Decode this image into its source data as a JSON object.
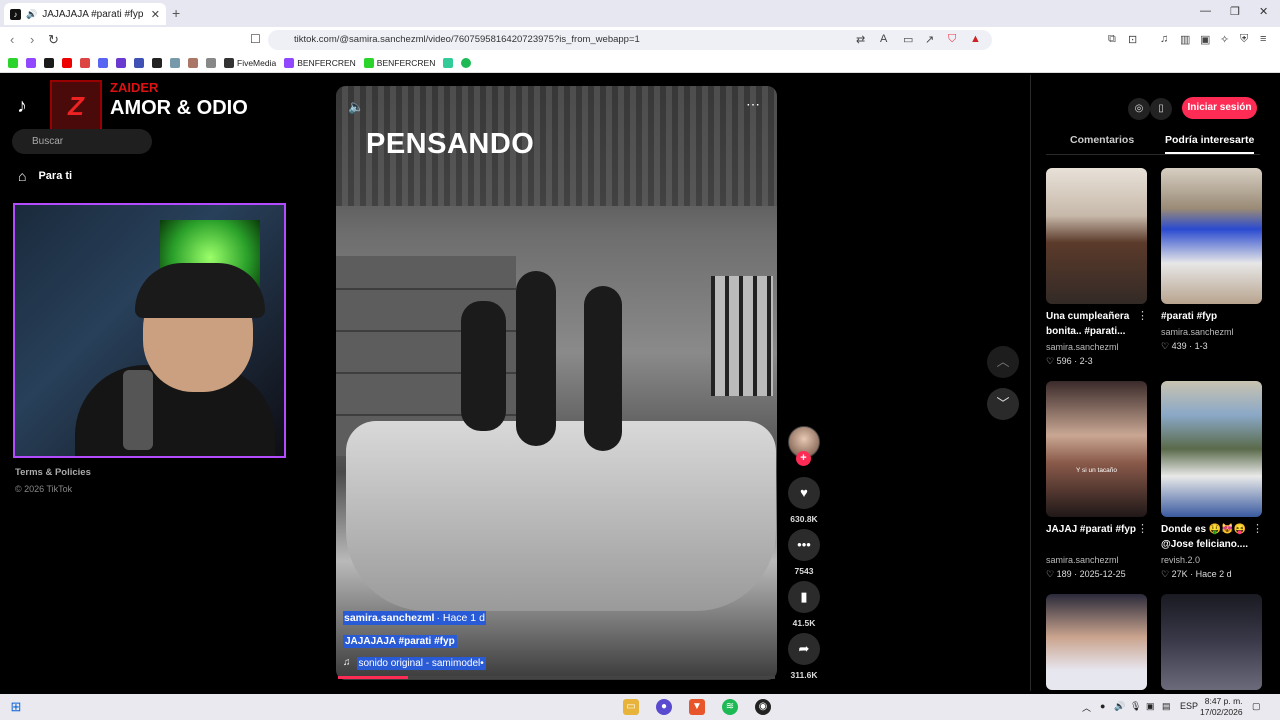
{
  "browser": {
    "tab_title": "JAJAJAJA #parati #fyp | TikTok",
    "url": "tiktok.com/@samira.sanchezml/video/7607595816420723975?is_from_webapp=1",
    "bookmarks": [
      "FiveMedia",
      "BENFERCREN",
      "BENFERCREN"
    ]
  },
  "sidebar": {
    "logo": "TikTok",
    "search_placeholder": "Buscar",
    "nav_parati": "Para ti",
    "footer_terms": "Terms & Policies",
    "footer_copyright": "© 2026 TikTok"
  },
  "stream_overlay": {
    "streamer": "ZAIDER",
    "song": "AMOR & ODIO"
  },
  "video": {
    "overlay_text": "PENSANDO",
    "author": "samira.sanchezml",
    "time": "· Hace 1 d",
    "caption": "JAJAJAJA #parati #fyp",
    "sound": "sonido original - samimodel•",
    "likes": "630.8K",
    "comments": "7543",
    "saves": "41.5K",
    "shares": "311.6K",
    "progress": 0.16
  },
  "right_panel": {
    "login_label": "Iniciar sesión",
    "tab_comments": "Comentarios",
    "tab_interest": "Podría interesarte",
    "cards": [
      {
        "title": "Una cumpleañera bonita.. #parati...",
        "author": "samira.sanchezml",
        "meta": "596 · 2-3"
      },
      {
        "title": "#parati #fyp",
        "author": "samira.sanchezml",
        "meta": "439 · 1-3"
      },
      {
        "title": "JAJAJ #parati #fyp",
        "author": "samira.sanchezml",
        "meta": "189 · 2025-12-25"
      },
      {
        "title": "Donde es 🤑😻😝 @Jose feliciano....",
        "author": "revish.2.0",
        "meta": "27K · Hace 2 d"
      }
    ],
    "card3_overlay": "Y si un tacaño"
  },
  "taskbar": {
    "lang": "ESP",
    "time": "8:47 p. m.",
    "date": "17/02/2026"
  },
  "colors": {
    "accent": "#fe2c55",
    "selection": "#2a5bd7",
    "webcam_border": "#b34bff"
  }
}
